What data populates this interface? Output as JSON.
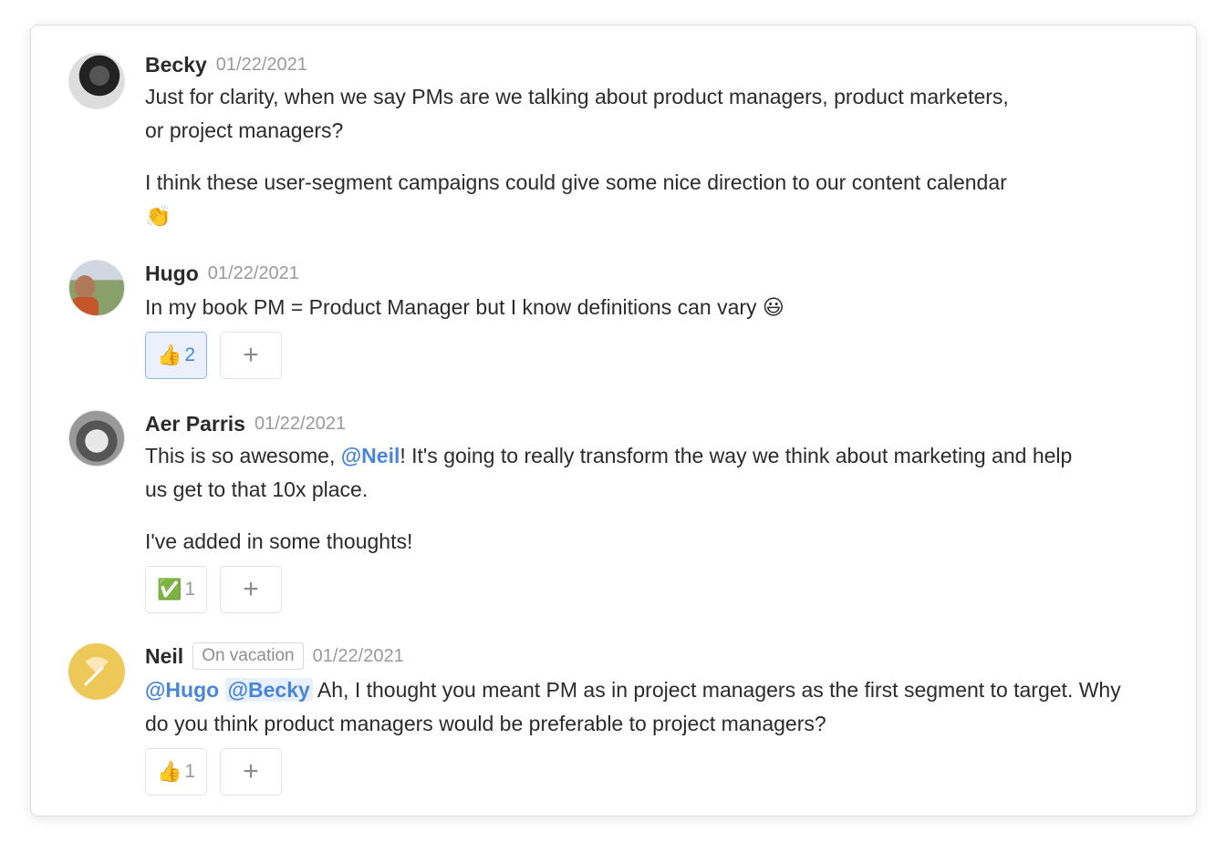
{
  "messages": [
    {
      "author": "Becky",
      "date": "01/22/2021",
      "paragraphs": [
        "Just for clarity, when we say PMs are we talking about product managers, product marketers, or project managers?",
        "I think these user-segment campaigns could give some nice direction to our content calendar 👏"
      ]
    },
    {
      "author": "Hugo",
      "date": "01/22/2021",
      "text": "In my book PM = Product Manager but I know definitions can vary 😃",
      "reaction": {
        "emoji": "👍",
        "count": "2",
        "active": true
      },
      "add_label": "+"
    },
    {
      "author": "Aer Parris",
      "date": "01/22/2021",
      "text_before": "This is so awesome, ",
      "mention": "@Neil",
      "text_after": "! It's going to really transform the way we think about marketing and help us get to that 10x place.",
      "text2": "I've added in some thoughts!",
      "reaction": {
        "emoji": "✅",
        "count": "1",
        "active": false
      },
      "add_label": "+"
    },
    {
      "author": "Neil",
      "status_badge": "On vacation",
      "date": "01/22/2021",
      "mention1": "@Hugo",
      "mention2": "@Becky",
      "text": " Ah, I thought you meant PM as in project managers as the first segment to target. Why do you think product managers would be preferable to project managers?",
      "reaction": {
        "emoji": "👍",
        "count": "1",
        "active": false
      },
      "add_label": "+"
    }
  ],
  "colors": {
    "mention": "#4a86d8",
    "neil_avatar": "#efc85a"
  }
}
